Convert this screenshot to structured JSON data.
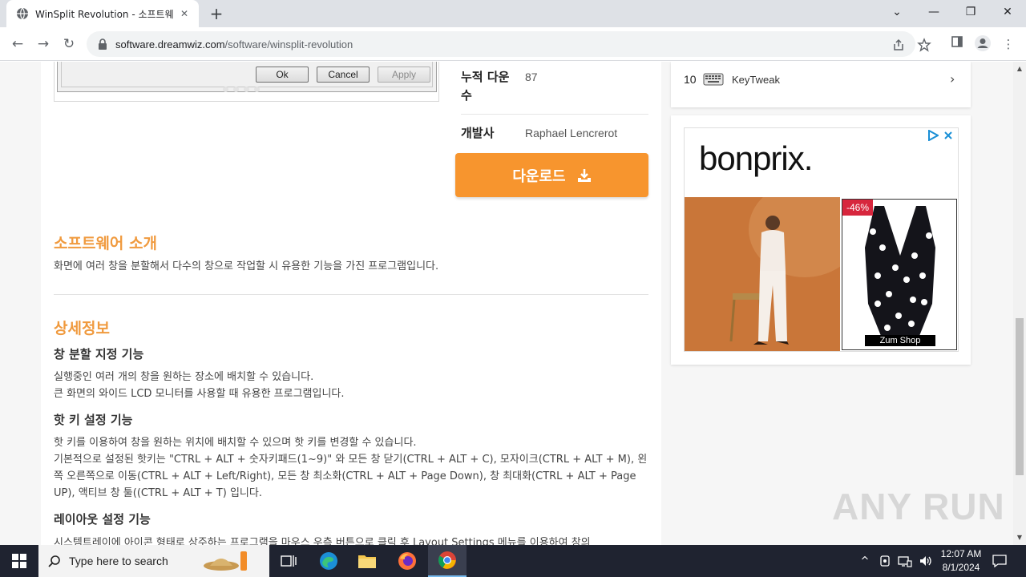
{
  "browser": {
    "tab_title": "WinSplit Revolution - 소프트웨어",
    "url_domain": "software.dreamwiz.com",
    "url_path": "/software/winsplit-revolution",
    "window_controls": {
      "minimize": "—",
      "restore": "❐",
      "close": "✕",
      "dropdown": "⌄"
    }
  },
  "dialog": {
    "ok": "Ok",
    "cancel": "Cancel",
    "apply": "Apply"
  },
  "info": {
    "downloads_label": "누적 다운\n수",
    "downloads_label_line1": "누적 다운",
    "downloads_label_line2": "수",
    "downloads_value": "87",
    "developer_label": "개발사",
    "developer_value": "Raphael Lencrerot",
    "download_button": "다운로드"
  },
  "intro": {
    "title": "소프트웨어 소개",
    "text": "화면에 여러 창을 분할해서 다수의 창으로 작업할 시 유용한 기능을 가진 프로그램입니다."
  },
  "details": {
    "title": "상세정보",
    "features": [
      {
        "title": "창 분할 지정 기능",
        "lines": [
          "실행중인 여러 개의 창을 원하는 장소에 배치할 수 있습니다.",
          "큰 화면의 와이드 LCD 모니터를 사용할 때 유용한 프로그램입니다."
        ]
      },
      {
        "title": "핫 키 설정 기능",
        "lines": [
          "핫 키를 이용하여 창을 원하는 위치에 배치할 수 있으며 핫 키를 변경할 수 있습니다.",
          "기본적으로 설정된 핫키는 \"CTRL + ALT + 숫자키패드(1~9)\" 와 모든 창 닫기(CTRL + ALT + C), 모자이크(CTRL + ALT + M), 왼쪽 오른쪽으로 이동(CTRL + ALT + Left/Right), 모든 창 최소화(CTRL + ALT + Page Down), 창 최대화(CTRL + ALT + Page UP), 액티브 창 툴((CTRL + ALT + T) 입니다."
        ]
      },
      {
        "title": "레이아웃 설정 기능",
        "lines": [
          "시스템트레이에 아이콘 형태로 상주하는 프로그램을 마우스 우측 버튼으로 클릭 후 Layout Settings 메뉴를 이용하여 창의"
        ]
      }
    ]
  },
  "sidebar": {
    "ranking_item": {
      "rank": "10",
      "name": "KeyTweak",
      "icon": "keyboard-icon"
    }
  },
  "ad": {
    "brand": "bonprix.",
    "discount": "-46%",
    "shop": "Zum Shop",
    "colors": {
      "discount": "#d7263d",
      "photo_bg": "#c8733a"
    }
  },
  "watermark": "ANY RUN",
  "taskbar": {
    "search_placeholder": "Type here to search",
    "time": "12:07 AM",
    "date": "8/1/2024"
  },
  "colors": {
    "accent": "#f09a3e",
    "download_button": "#f7952e",
    "taskbar": "#1f2330"
  }
}
